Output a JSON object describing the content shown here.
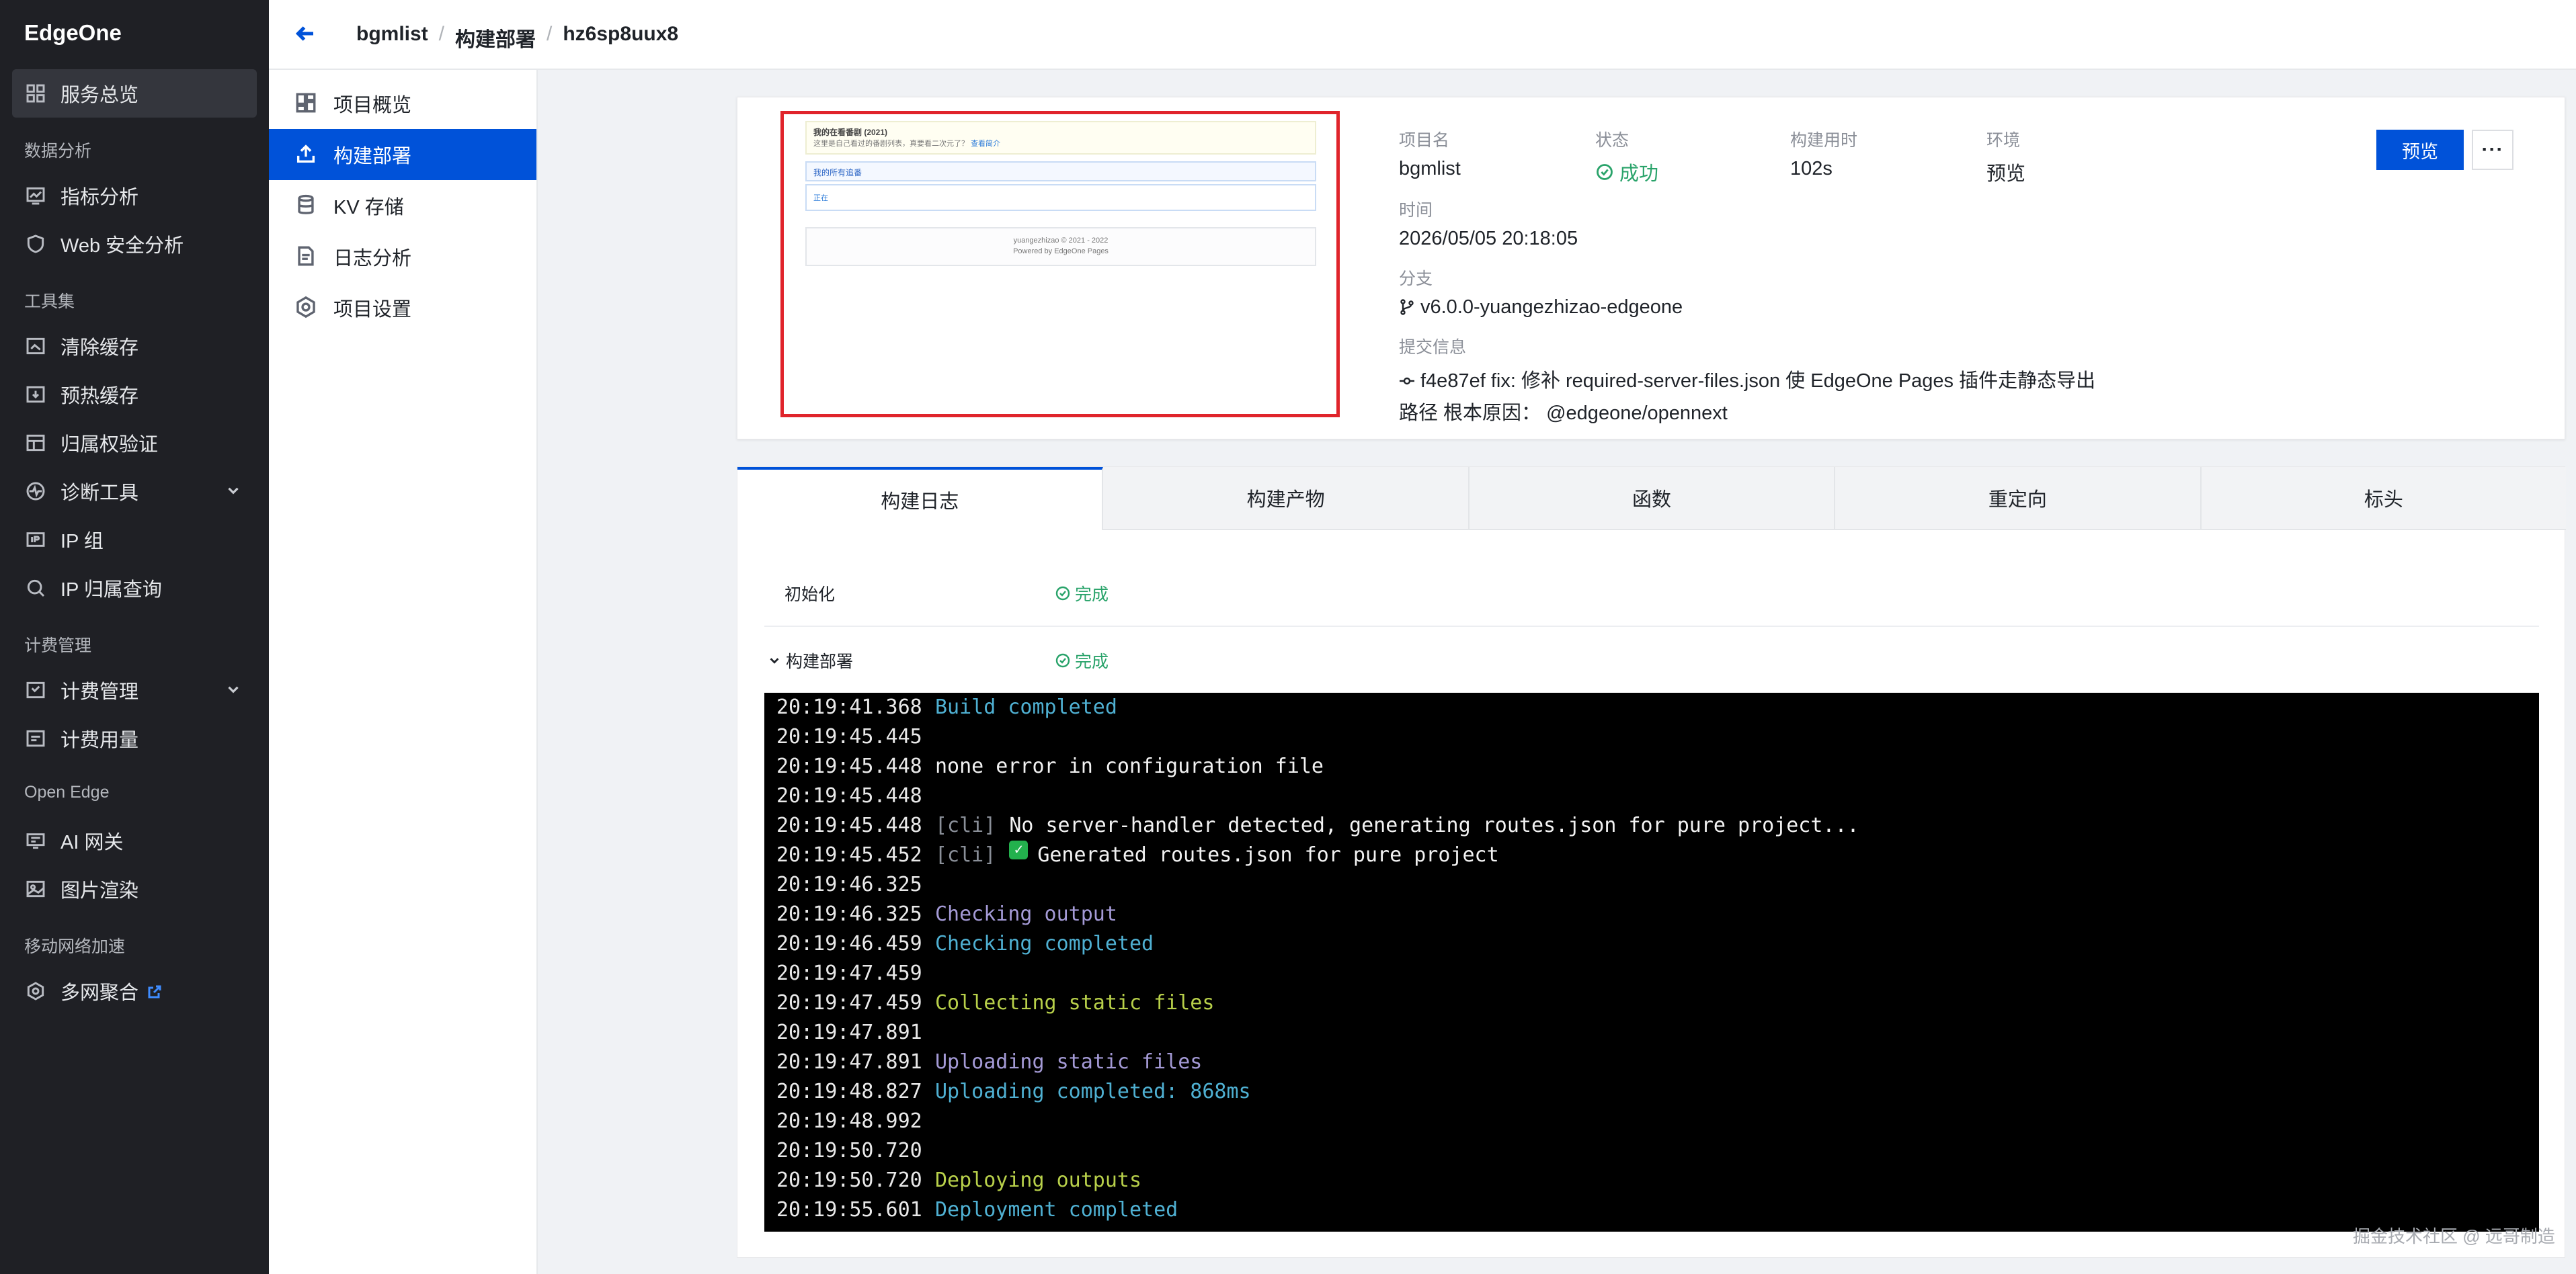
{
  "sidebar": {
    "brand": "EdgeOne",
    "items": [
      {
        "label": "服务总览",
        "icon": "dashboard-grid-icon"
      },
      {
        "group": "数据分析"
      },
      {
        "label": "指标分析",
        "icon": "chart-monitor-icon"
      },
      {
        "label": "Web 安全分析",
        "icon": "shield-icon"
      },
      {
        "group": "工具集"
      },
      {
        "label": "清除缓存",
        "icon": "purge-cache-icon"
      },
      {
        "label": "预热缓存",
        "icon": "prefetch-cache-icon"
      },
      {
        "label": "归属权验证",
        "icon": "ownership-verify-icon"
      },
      {
        "label": "诊断工具",
        "icon": "diagnostic-icon"
      },
      {
        "label": "IP 组",
        "icon": "ip-group-icon"
      },
      {
        "label": "IP 归属查询",
        "icon": "search-icon"
      },
      {
        "group": "计费管理"
      },
      {
        "label": "计费管理",
        "icon": "billing-icon"
      },
      {
        "label": "计费用量",
        "icon": "billing-usage-icon"
      },
      {
        "group": "Open Edge"
      },
      {
        "label": "AI 网关",
        "icon": "ai-gateway-icon"
      },
      {
        "label": "图片渲染",
        "icon": "image-icon"
      },
      {
        "group": "移动网络加速"
      },
      {
        "label": "多网聚合",
        "icon": "multi-network-icon"
      }
    ]
  },
  "breadcrumb": {
    "project": "bgmlist",
    "section": "构建部署",
    "deployment_id": "hz6sp8uux8",
    "separator": "/"
  },
  "submenu": [
    {
      "label": "项目概览",
      "icon": "overview-icon"
    },
    {
      "label": "构建部署",
      "icon": "upload-deploy-icon"
    },
    {
      "label": "KV 存储",
      "icon": "database-icon"
    },
    {
      "label": "日志分析",
      "icon": "log-document-icon"
    },
    {
      "label": "项目设置",
      "icon": "settings-icon"
    }
  ],
  "preview": {
    "top_title": "我的在看番剧 (2021)",
    "top_text": "这里是自己看过的番剧列表，真要看二次元了？",
    "top_link": "查看简介",
    "section_title": "我的所有追番",
    "box_text": "正在",
    "footer_line1": "yuangezhizao © 2021 - 2022",
    "footer_line2": "Powered by EdgeOne Pages"
  },
  "deployment": {
    "project_name_label": "项目名",
    "project_name": "bgmlist",
    "status_label": "状态",
    "status": "成功",
    "build_time_label": "构建用时",
    "build_time": "102s",
    "env_label": "环境",
    "env": "预览",
    "time_label": "时间",
    "time": "2026/05/05 20:18:05",
    "branch_label": "分支",
    "branch": "v6.0.0-yuangezhizao-edgeone",
    "commit_label": "提交信息",
    "commit_hash": "f4e87ef",
    "commit_msg_line1": "fix: 修补 required-server-files.json 使 EdgeOne Pages 插件走静态导出",
    "commit_msg_line2": "路径 根本原因： @edgeone/opennext",
    "preview_button": "预览",
    "more_button": "···"
  },
  "tabs": [
    "构建日志",
    "构建产物",
    "函数",
    "重定向",
    "标头"
  ],
  "steps": [
    {
      "name": "初始化",
      "status": "完成"
    },
    {
      "name": "构建部署",
      "status": "完成"
    }
  ],
  "log": [
    {
      "time": "20:19:41.368",
      "tag": "",
      "msg": "Build completed",
      "color": "cyan"
    },
    {
      "time": "20:19:45.445",
      "tag": "",
      "msg": "",
      "color": "white"
    },
    {
      "time": "20:19:45.448",
      "tag": "",
      "msg": "none error in configuration file",
      "color": "white"
    },
    {
      "time": "20:19:45.448",
      "tag": "",
      "msg": "",
      "color": "white"
    },
    {
      "time": "20:19:45.448",
      "tag": "[cli]",
      "msg": "No server-handler detected, generating routes.json for pure project...",
      "color": "white"
    },
    {
      "time": "20:19:45.452",
      "tag": "[cli]",
      "msg": "Generated routes.json for pure project",
      "color": "white",
      "check": true
    },
    {
      "time": "20:19:46.325",
      "tag": "",
      "msg": "",
      "color": "white"
    },
    {
      "time": "20:19:46.325",
      "tag": "",
      "msg": "Checking output",
      "color": "purple"
    },
    {
      "time": "20:19:46.459",
      "tag": "",
      "msg": "Checking completed",
      "color": "cyan"
    },
    {
      "time": "20:19:47.459",
      "tag": "",
      "msg": "",
      "color": "white"
    },
    {
      "time": "20:19:47.459",
      "tag": "",
      "msg": "Collecting static files",
      "color": "green"
    },
    {
      "time": "20:19:47.891",
      "tag": "",
      "msg": "",
      "color": "white"
    },
    {
      "time": "20:19:47.891",
      "tag": "",
      "msg": "Uploading static files",
      "color": "purple"
    },
    {
      "time": "20:19:48.827",
      "tag": "",
      "msg": "Uploading completed: 868ms",
      "color": "cyan"
    },
    {
      "time": "20:19:48.992",
      "tag": "",
      "msg": "",
      "color": "white"
    },
    {
      "time": "20:19:50.720",
      "tag": "",
      "msg": "",
      "color": "white"
    },
    {
      "time": "20:19:50.720",
      "tag": "",
      "msg": "Deploying outputs",
      "color": "green"
    },
    {
      "time": "20:19:55.601",
      "tag": "",
      "msg": "Deployment completed",
      "color": "cyan"
    }
  ],
  "watermark": "掘金技术社区 @ 远哥制造",
  "colors": {
    "accent": "#0052d9",
    "success": "#29a36a",
    "sidebar_bg": "#1f2025",
    "highlight_border": "#e0242b"
  }
}
